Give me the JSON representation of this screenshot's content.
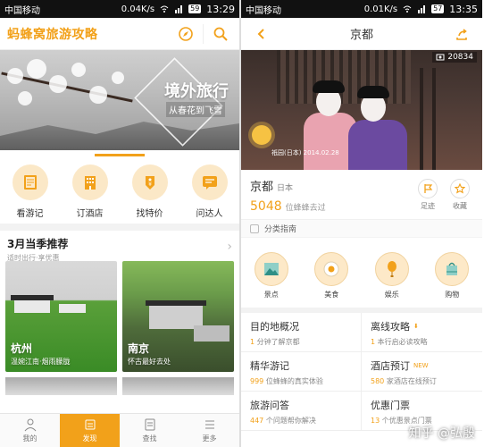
{
  "left": {
    "status": {
      "carrier": "中国移动",
      "net": "0.04K/s",
      "battery": "59",
      "time": "13:29"
    },
    "header": {
      "brand_name": "蚂蜂窝",
      "brand_suffix": "旅游攻略"
    },
    "banner": {
      "title": "境外旅行",
      "subtitle": "从春花到飞雪"
    },
    "quick": [
      {
        "label": "看游记",
        "icon": "book-icon"
      },
      {
        "label": "订酒店",
        "icon": "hotel-icon"
      },
      {
        "label": "找特价",
        "icon": "price-tag-icon"
      },
      {
        "label": "问达人",
        "icon": "chat-icon"
      }
    ],
    "section": {
      "title": "3月当季推荐",
      "subtitle": "适时出行·享优惠"
    },
    "cards": [
      {
        "title": "杭州",
        "subtitle": "温婉江南·烟雨朦胧"
      },
      {
        "title": "南京",
        "subtitle": "怀古最好去处"
      }
    ],
    "nav": [
      {
        "label": "我的",
        "icon": "profile-icon"
      },
      {
        "label": "发现",
        "icon": "discover-icon"
      },
      {
        "label": "查找",
        "icon": "search-icon"
      },
      {
        "label": "更多",
        "icon": "more-icon"
      }
    ]
  },
  "right": {
    "status": {
      "carrier": "中国移动",
      "net": "0.01K/s",
      "battery": "57",
      "time": "13:35"
    },
    "header": {
      "title": "京都"
    },
    "hero": {
      "views": "20834",
      "caption": "祇园(日本)  2014.02.28"
    },
    "city": {
      "name": "京都",
      "country": "日本",
      "visits": "5048",
      "visits_suffix": "位蜂蜂去过"
    },
    "actions": [
      {
        "label": "足迹",
        "icon": "flag-icon"
      },
      {
        "label": "收藏",
        "icon": "star-icon"
      }
    ],
    "category_header": "分类指南",
    "categories": [
      {
        "label": "景点",
        "icon": "mountain-icon"
      },
      {
        "label": "美食",
        "icon": "egg-icon"
      },
      {
        "label": "娱乐",
        "icon": "balloon-icon"
      },
      {
        "label": "购物",
        "icon": "shopping-bag-icon"
      }
    ],
    "info": [
      {
        "title": "目的地概况",
        "sub_num": "1",
        "sub_text": "分钟了解京都"
      },
      {
        "title": "离线攻略",
        "sub_num": "1",
        "sub_text": "本行启必读攻略",
        "tag": "⬇"
      },
      {
        "title": "精华游记",
        "sub_num": "999",
        "sub_text": "位蜂蜂的真实体验"
      },
      {
        "title": "酒店预订",
        "sub_num": "580",
        "sub_text": "家酒店在线预订",
        "tag": "NEW"
      },
      {
        "title": "旅游问答",
        "sub_num": "447",
        "sub_text": "个问题帮你解决"
      },
      {
        "title": "优惠门票",
        "sub_num": "13",
        "sub_text": "个优惠景点门票"
      }
    ],
    "watermark": "知乎 @弘殷"
  },
  "colors": {
    "accent": "#f2a11a"
  }
}
